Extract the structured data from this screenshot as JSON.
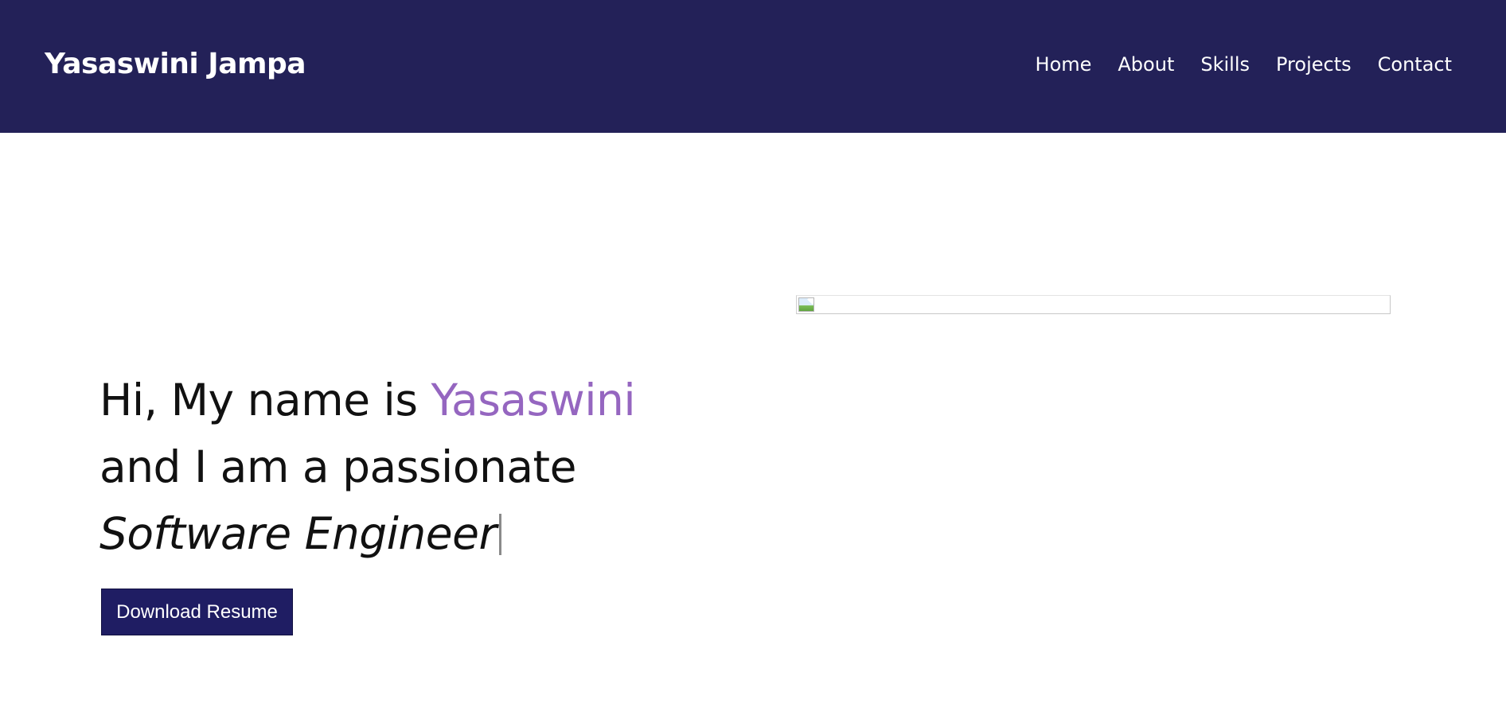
{
  "header": {
    "brand": "Yasaswini Jampa",
    "nav": [
      "Home",
      "About",
      "Skills",
      "Projects",
      "Contact"
    ]
  },
  "hero": {
    "greeting_prefix": "Hi, My name is ",
    "name": "Yasaswini",
    "line2": "and I am a passionate",
    "role": "Software Engineer",
    "button_label": "Download Resume"
  },
  "colors": {
    "navbar_bg": "#232158",
    "accent": "#9566c0",
    "button_bg": "#1f1d63",
    "text": "#111111"
  },
  "icons": {
    "broken_image": "broken-image-icon",
    "typing_cursor": "text-cursor-icon"
  }
}
